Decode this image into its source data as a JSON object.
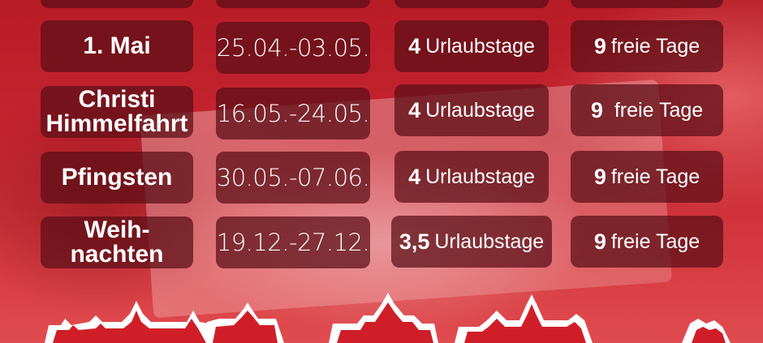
{
  "rows": [
    {
      "holiday": "1. Mai",
      "dates": "25.04.-03.05.",
      "vacation_num": "4",
      "vacation_label": "Urlaubstage",
      "free_num": "9",
      "free_label": "freie Tage"
    },
    {
      "holiday_line1": "Christi",
      "holiday_line2": "Himmelfahrt",
      "dates": "16.05.-24.05.",
      "vacation_num": "4",
      "vacation_label": "Urlaubstage",
      "free_num": "9",
      "free_label": "freie Tage"
    },
    {
      "holiday": "Pfingsten",
      "dates": "30.05.-07.06.",
      "vacation_num": "4",
      "vacation_label": "Urlaubstage",
      "free_num": "9",
      "free_label": "freie Tage"
    },
    {
      "holiday_line1": "Weih-",
      "holiday_line2": "nachten",
      "dates": "19.12.-27.12.",
      "vacation_num": "3,5",
      "vacation_label": "Urlaubstage",
      "free_num": "9",
      "free_label": "freie Tage"
    }
  ],
  "colors": {
    "background": "#c8202a",
    "cell": "#5a0e16",
    "text": "#ffffff"
  }
}
